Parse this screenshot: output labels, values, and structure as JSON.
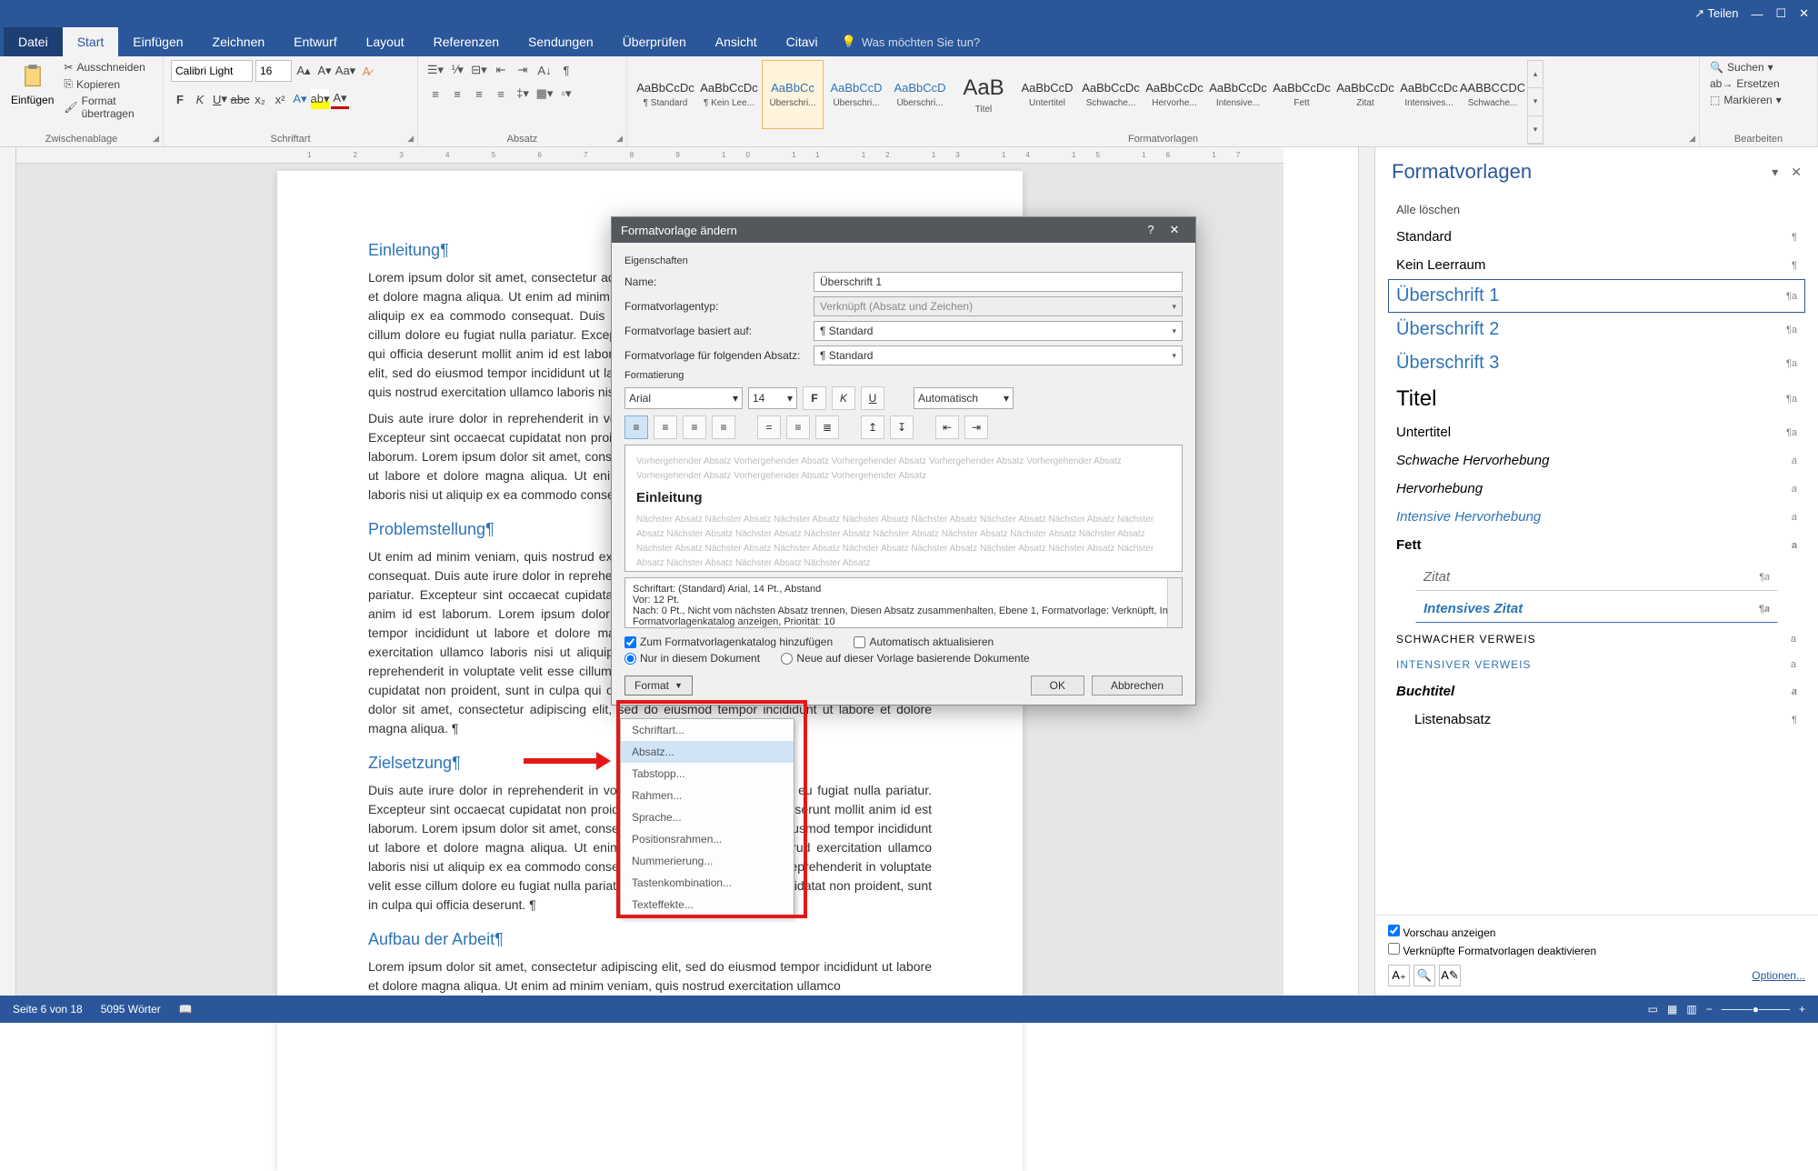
{
  "titlebar": {
    "share": "Teilen"
  },
  "tabs": {
    "datei": "Datei",
    "start": "Start",
    "einfuegen": "Einfügen",
    "zeichnen": "Zeichnen",
    "entwurf": "Entwurf",
    "layout": "Layout",
    "referenzen": "Referenzen",
    "sendungen": "Sendungen",
    "ueberpruefen": "Überprüfen",
    "ansicht": "Ansicht",
    "citavi": "Citavi",
    "tellme": "Was möchten Sie tun?"
  },
  "clipboard": {
    "paste": "Einfügen",
    "cut": "Ausschneiden",
    "copy": "Kopieren",
    "painter": "Format übertragen",
    "group": "Zwischenablage"
  },
  "font": {
    "name": "Calibri Light",
    "size": "16",
    "group": "Schriftart"
  },
  "para": {
    "group": "Absatz"
  },
  "styles_gallery": {
    "group": "Formatvorlagen",
    "items": [
      {
        "preview": "AaBbCcDc",
        "name": "¶ Standard"
      },
      {
        "preview": "AaBbCcDc",
        "name": "¶ Kein Lee..."
      },
      {
        "preview": "AaBbCc",
        "name": "Überschri...",
        "h1": true,
        "sel": true
      },
      {
        "preview": "AaBbCcD",
        "name": "Überschri...",
        "h1": true
      },
      {
        "preview": "AaBbCcD",
        "name": "Überschri...",
        "h1": true
      },
      {
        "preview": "AaB",
        "name": "Titel",
        "big": true
      },
      {
        "preview": "AaBbCcD",
        "name": "Untertitel"
      },
      {
        "preview": "AaBbCcDc",
        "name": "Schwache..."
      },
      {
        "preview": "AaBbCcDc",
        "name": "Hervorhe..."
      },
      {
        "preview": "AaBbCcDc",
        "name": "Intensive..."
      },
      {
        "preview": "AaBbCcDc",
        "name": "Fett"
      },
      {
        "preview": "AaBbCcDc",
        "name": "Zitat"
      },
      {
        "preview": "AaBbCcDc",
        "name": "Intensives..."
      },
      {
        "preview": "AABBCCDC",
        "name": "Schwache..."
      }
    ]
  },
  "editing": {
    "find": "Suchen",
    "replace": "Ersetzen",
    "select": "Markieren",
    "group": "Bearbeiten"
  },
  "doc": {
    "h1": "Einleitung",
    "p1": "Lorem ipsum dolor sit amet, consectetur adipiscing elit, sed do eiusmod tempor incididunt ut labore et dolore magna aliqua. Ut enim ad minim veniam, quis nostrud exercitation ullamco laboris nisi ut aliquip ex ea commodo consequat. Duis aute irure dolor in reprehenderit in voluptate velit esse cillum dolore eu fugiat nulla pariatur. Excepteur sint occaecat cupidatat non proident, sunt in culpa qui officia deserunt mollit anim id est laborum. Lorem ipsum dolor sit amet, consectetur adipiscing elit, sed do eiusmod tempor incididunt ut labore et dolore magna aliqua. Ut enim ad minim veniam, quis nostrud exercitation ullamco laboris nisi ut aliquip ex ea commodo consequat. ¶",
    "p1b": "Duis aute irure dolor in reprehenderit in voluptate velit esse cillum dolore eu fugiat nulla pariatur. Excepteur sint occaecat cupidatat non proident, sunt in culpa qui officia deserunt mollit anim id est laborum. Lorem ipsum dolor sit amet, consectetur adipiscing elit, sed do eiusmod tempor incididunt ut labore et dolore magna aliqua. Ut enim ad minim veniam, quis nostrud exercitation ullamco laboris nisi ut aliquip ex ea commodo consequat. ¶",
    "h2": "Problemstellung",
    "p2": "Ut enim ad minim veniam, quis nostrud exercitation ullamco laboris nisi ut aliquip ex ea commodo consequat. Duis aute irure dolor in reprehenderit in voluptate velit esse cillum dolore eu fugiat nulla pariatur. Excepteur sint occaecat cupidatat non proident, sunt in culpa qui officia deserunt mollit anim id est laborum. Lorem ipsum dolor sit amet, consectetur adipiscing elit, sed do eiusmod tempor incididunt ut labore et dolore magna aliqua. Ut enim ad minim veniam, quis nostrud exercitation ullamco laboris nisi ut aliquip ex ea commodo consequat. Duis aute irure dolor in reprehenderit in voluptate velit esse cillum dolore eu fugiat nulla pariatur. Excepteur sint occaecat cupidatat non proident, sunt in culpa qui officia deserunt mollit anim id est laborum. Lorem ipsum dolor sit amet, consectetur adipiscing elit, sed do eiusmod tempor incididunt ut labore et dolore magna aliqua. ¶",
    "h3": "Zielsetzung",
    "p3": "Duis aute irure dolor in reprehenderit in voluptate velit esse cillum dolore eu fugiat nulla pariatur. Excepteur sint occaecat cupidatat non proident, sunt in culpa qui officia deserunt mollit anim id est laborum. Lorem ipsum dolor sit amet, consectetur adipiscing elit, sed do eiusmod tempor incididunt ut labore et dolore magna aliqua. Ut enim ad minim veniam, quis nostrud exercitation ullamco laboris nisi ut aliquip ex ea commodo consequat. Duis aute irure dolor in reprehenderit in voluptate velit esse cillum dolore eu fugiat nulla pariatur. Excepteur sint occaecat cupidatat non proident, sunt in culpa qui officia deserunt. ¶",
    "h4": "Aufbau der Arbeit",
    "p4": "Lorem ipsum dolor sit amet, consectetur adipiscing elit, sed do eiusmod tempor incididunt ut labore et dolore magna aliqua. Ut enim ad minim veniam, quis nostrud exercitation ullamco"
  },
  "pane": {
    "title": "Formatvorlagen",
    "clear": "Alle löschen",
    "items": [
      {
        "label": "Standard",
        "m": "¶"
      },
      {
        "label": "Kein Leerraum",
        "m": "¶"
      },
      {
        "label": "Überschrift 1",
        "m": "¶a",
        "h1": true,
        "sel": true
      },
      {
        "label": "Überschrift 2",
        "m": "¶a",
        "h1": true
      },
      {
        "label": "Überschrift 3",
        "m": "¶a",
        "h1": true
      },
      {
        "label": "Titel",
        "m": "¶a",
        "titel": true
      },
      {
        "label": "Untertitel",
        "m": "¶a"
      },
      {
        "label": "Schwache Hervorhebung",
        "m": "a",
        "italic": true
      },
      {
        "label": "Hervorhebung",
        "m": "a",
        "italic": true
      },
      {
        "label": "Intensive Hervorhebung",
        "m": "a",
        "italic": true,
        "color": "#2e74b5"
      },
      {
        "label": "Fett",
        "m": "a",
        "bold": true
      },
      {
        "label": "Zitat",
        "m": "¶a",
        "zitat": true
      },
      {
        "label": "Intensives Zitat",
        "m": "¶a",
        "intzitat": true
      },
      {
        "label": "SCHWACHER VERWEIS",
        "m": "a",
        "small": true
      },
      {
        "label": "INTENSIVER VERWEIS",
        "m": "a",
        "small": true,
        "color": "#2e74b5"
      },
      {
        "label": "Buchtitel",
        "m": "a",
        "bold": true,
        "italic": true
      },
      {
        "label": "Listenabsatz",
        "m": "¶",
        "indent": true
      }
    ],
    "preview_cb": "Vorschau anzeigen",
    "linked_cb": "Verknüpfte Formatvorlagen deaktivieren",
    "options": "Optionen..."
  },
  "dialog": {
    "title": "Formatvorlage ändern",
    "props": "Eigenschaften",
    "name_lbl": "Name:",
    "name_val": "Überschrift 1",
    "type_lbl": "Formatvorlagentyp:",
    "type_val": "Verknüpft (Absatz und Zeichen)",
    "based_lbl": "Formatvorlage basiert auf:",
    "based_val": "¶ Standard",
    "next_lbl": "Formatvorlage für folgenden Absatz:",
    "next_val": "¶ Standard",
    "formatting": "Formatierung",
    "font": "Arial",
    "size": "14",
    "color": "Automatisch",
    "prev_before": "Vorhergehender Absatz Vorhergehender Absatz Vorhergehender Absatz Vorhergehender Absatz Vorhergehender Absatz Vorhergehender Absatz Vorhergehender Absatz Vorhergehender Absatz",
    "prev_main": "Einleitung",
    "prev_after": "Nächster Absatz Nächster Absatz Nächster Absatz Nächster Absatz Nächster Absatz Nächster Absatz Nächster Absatz Nächster Absatz Nächster Absatz Nächster Absatz Nächster Absatz Nächster Absatz Nächster Absatz Nächster Absatz Nächster Absatz Nächster Absatz Nächster Absatz Nächster Absatz Nächster Absatz Nächster Absatz Nächster Absatz Nächster Absatz Nächster Absatz Nächster Absatz Nächster Absatz Nächster Absatz",
    "desc1": "Schriftart: (Standard) Arial, 14 Pt., Abstand",
    "desc2": "   Vor:  12 Pt.",
    "desc3": "   Nach:  0 Pt., Nicht vom nächsten Absatz trennen, Diesen Absatz zusammenhalten, Ebene 1, Formatvorlage: Verknüpft, Im Formatvorlagenkatalog anzeigen, Priorität: 10",
    "cb_catalog": "Zum Formatvorlagenkatalog hinzufügen",
    "cb_auto": "Automatisch aktualisieren",
    "rb_doc": "Nur in diesem Dokument",
    "rb_tpl": "Neue auf dieser Vorlage basierende Dokumente",
    "format_btn": "Format",
    "ok": "OK",
    "cancel": "Abbrechen"
  },
  "format_menu": [
    "Schriftart...",
    "Absatz...",
    "Tabstopp...",
    "Rahmen...",
    "Sprache...",
    "Positionsrahmen...",
    "Nummerierung...",
    "Tastenkombination...",
    "Texteffekte..."
  ],
  "status": {
    "page": "Seite 6 von 18",
    "words": "5095 Wörter"
  }
}
